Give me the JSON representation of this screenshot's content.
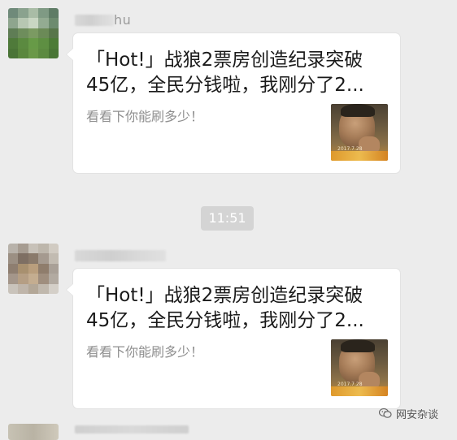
{
  "chat": {
    "messages": [
      {
        "sender_name_visible": "hu",
        "card": {
          "title": "「Hot!」战狼2票房创造纪录突破\n45亿，全民分钱啦，我刚分了2...",
          "description": "看看下你能刷多少！",
          "thumbnail_date": "2017.7.28"
        }
      },
      {
        "sender_name_visible": "",
        "card": {
          "title": "「Hot!」战狼2票房创造纪录突破\n45亿，全民分钱啦，我刚分了2...",
          "description": "看看下你能刷多少！",
          "thumbnail_date": "2017.7.28"
        }
      }
    ],
    "time_separator": "11:51"
  },
  "watermark": {
    "text": "网安杂谈",
    "icon": "wechat-icon"
  },
  "colors": {
    "background": "#ececec",
    "bubble": "#ffffff",
    "time_badge": "#d4d4d4"
  }
}
